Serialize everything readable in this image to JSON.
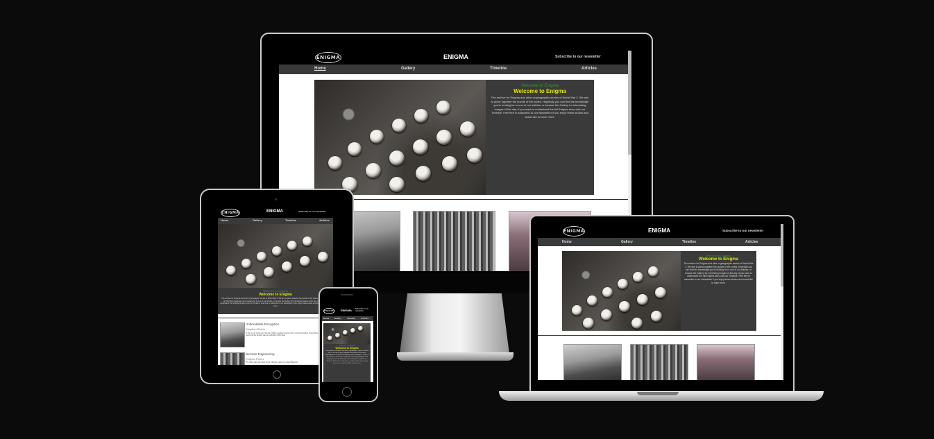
{
  "site": {
    "logo_text": "ENIGMA",
    "brand": "ENIGMA",
    "newsletter": "Subscribe to our newsletter",
    "nav": [
      "Home",
      "Gallery",
      "Timeline",
      "Articles"
    ],
    "hero": {
      "welcome_small": "Welcome to Enigma",
      "welcome": "Welcome to Enigma",
      "paragraph": "The archive for Enigma and other cryptographic stories of World War 2. We aim to piece together the puzzle of the codes. Hopefully you can find the knowledge you're looking for in one of our articles, or browse the Gallery for interesting images of the day. If you want to understand the full Enigma story visit our Timeline. Feel free to subscribe to our Newsletter if you enjoy these stories and would like to learn more."
    },
    "articles": [
      {
        "title": "Unbreakable Encryption",
        "subtitle": "Dispatch Riders",
        "snippet": "In the run up to the war, German military needed a secure form of communication. Typewriters had long been used, and the Enigma was an evolution of this idea."
      },
      {
        "title": "German Engineering",
        "subtitle": "Enigma Rotors",
        "snippet": "The rotors were the heart of the machine, each one wired differently."
      }
    ]
  }
}
